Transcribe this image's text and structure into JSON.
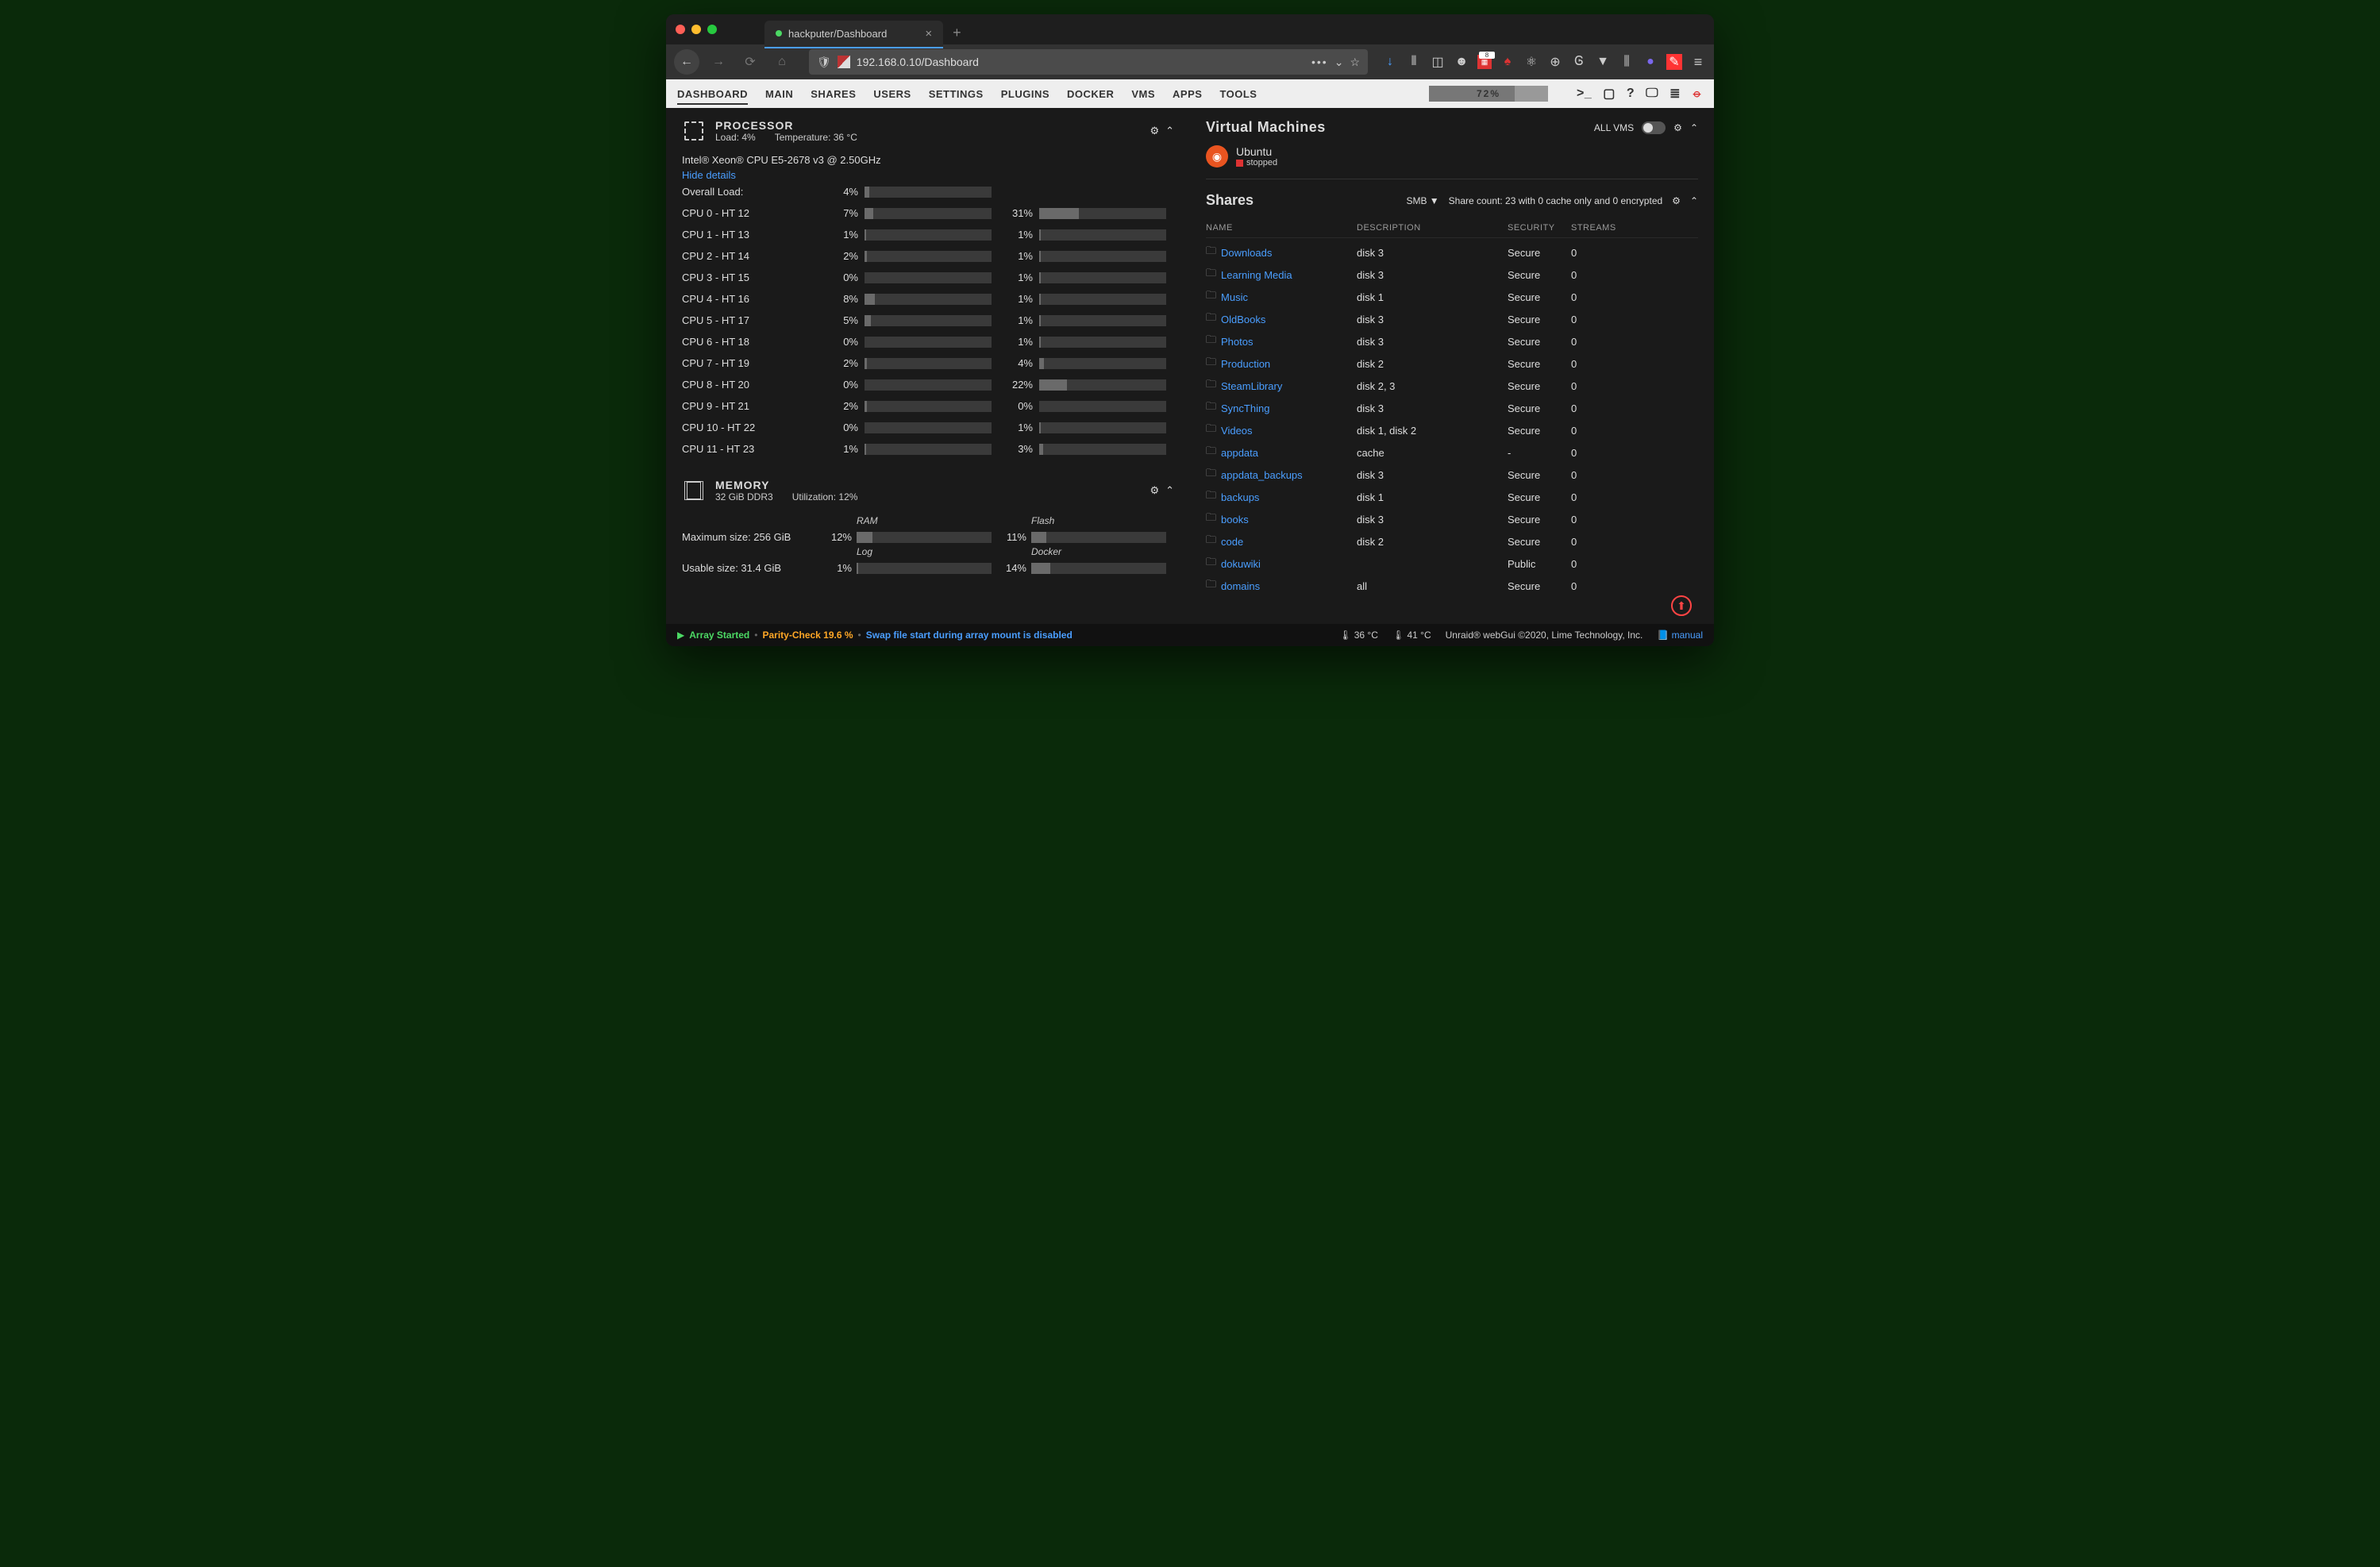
{
  "browser": {
    "tab_title": "hackputer/Dashboard",
    "url": "192.168.0.10/Dashboard"
  },
  "topnav": {
    "items": [
      "DASHBOARD",
      "MAIN",
      "SHARES",
      "USERS",
      "SETTINGS",
      "PLUGINS",
      "DOCKER",
      "VMS",
      "APPS",
      "TOOLS"
    ],
    "progress_pct": "72%"
  },
  "processor": {
    "title": "PROCESSOR",
    "load_label": "Load: 4%",
    "temp_label": "Temperature: 36 °C",
    "model": "Intel® Xeon® CPU E5-2678 v3 @ 2.50GHz",
    "hide_link": "Hide details",
    "overall_label": "Overall Load:",
    "overall_pct": 4,
    "cores": [
      {
        "label": "CPU 0 - HT 12",
        "a": 7,
        "b": 31
      },
      {
        "label": "CPU 1 - HT 13",
        "a": 1,
        "b": 1
      },
      {
        "label": "CPU 2 - HT 14",
        "a": 2,
        "b": 1
      },
      {
        "label": "CPU 3 - HT 15",
        "a": 0,
        "b": 1
      },
      {
        "label": "CPU 4 - HT 16",
        "a": 8,
        "b": 1
      },
      {
        "label": "CPU 5 - HT 17",
        "a": 5,
        "b": 1
      },
      {
        "label": "CPU 6 - HT 18",
        "a": 0,
        "b": 1
      },
      {
        "label": "CPU 7 - HT 19",
        "a": 2,
        "b": 4
      },
      {
        "label": "CPU 8 - HT 20",
        "a": 0,
        "b": 22
      },
      {
        "label": "CPU 9 - HT 21",
        "a": 2,
        "b": 0
      },
      {
        "label": "CPU 10 - HT 22",
        "a": 0,
        "b": 1
      },
      {
        "label": "CPU 11 - HT 23",
        "a": 1,
        "b": 3
      }
    ]
  },
  "memory": {
    "title": "MEMORY",
    "sub1": "32 GiB DDR3",
    "sub2": "Utilization: 12%",
    "max_label": "Maximum size: 256 GiB",
    "usable_label": "Usable size: 31.4 GiB",
    "cells": {
      "ram": {
        "label": "RAM",
        "pct": 12
      },
      "flash": {
        "label": "Flash",
        "pct": 11
      },
      "log": {
        "label": "Log",
        "pct": 1
      },
      "docker": {
        "label": "Docker",
        "pct": 14
      }
    }
  },
  "vms": {
    "title": "Virtual Machines",
    "all_label": "ALL VMS",
    "items": [
      {
        "name": "Ubuntu",
        "state": "stopped"
      }
    ]
  },
  "shares": {
    "title": "Shares",
    "proto": "SMB ▼",
    "meta": "Share count: 23 with 0 cache only and 0 encrypted",
    "cols": [
      "NAME",
      "DESCRIPTION",
      "SECURITY",
      "STREAMS"
    ],
    "rows": [
      {
        "name": "Downloads",
        "desc": "disk 3",
        "sec": "Secure",
        "str": "0"
      },
      {
        "name": "Learning Media",
        "desc": "disk 3",
        "sec": "Secure",
        "str": "0"
      },
      {
        "name": "Music",
        "desc": "disk 1",
        "sec": "Secure",
        "str": "0"
      },
      {
        "name": "OldBooks",
        "desc": "disk 3",
        "sec": "Secure",
        "str": "0"
      },
      {
        "name": "Photos",
        "desc": "disk 3",
        "sec": "Secure",
        "str": "0"
      },
      {
        "name": "Production",
        "desc": "disk 2",
        "sec": "Secure",
        "str": "0"
      },
      {
        "name": "SteamLibrary",
        "desc": "disk 2, 3",
        "sec": "Secure",
        "str": "0"
      },
      {
        "name": "SyncThing",
        "desc": "disk 3",
        "sec": "Secure",
        "str": "0"
      },
      {
        "name": "Videos",
        "desc": "disk 1, disk 2",
        "sec": "Secure",
        "str": "0"
      },
      {
        "name": "appdata",
        "desc": "cache",
        "sec": "-",
        "str": "0"
      },
      {
        "name": "appdata_backups",
        "desc": "disk 3",
        "sec": "Secure",
        "str": "0"
      },
      {
        "name": "backups",
        "desc": "disk 1",
        "sec": "Secure",
        "str": "0"
      },
      {
        "name": "books",
        "desc": "disk 3",
        "sec": "Secure",
        "str": "0"
      },
      {
        "name": "code",
        "desc": "disk 2",
        "sec": "Secure",
        "str": "0"
      },
      {
        "name": "dokuwiki",
        "desc": "",
        "sec": "Public",
        "str": "0"
      },
      {
        "name": "domains",
        "desc": "all",
        "sec": "Secure",
        "str": "0"
      }
    ]
  },
  "status": {
    "array": "Array Started",
    "parity": "Parity-Check 19.6 %",
    "swap": "Swap file start during array mount is disabled",
    "temp1": "36 °C",
    "temp2": "41 °C",
    "copyright": "Unraid® webGui ©2020, Lime Technology, Inc.",
    "manual": "manual"
  }
}
